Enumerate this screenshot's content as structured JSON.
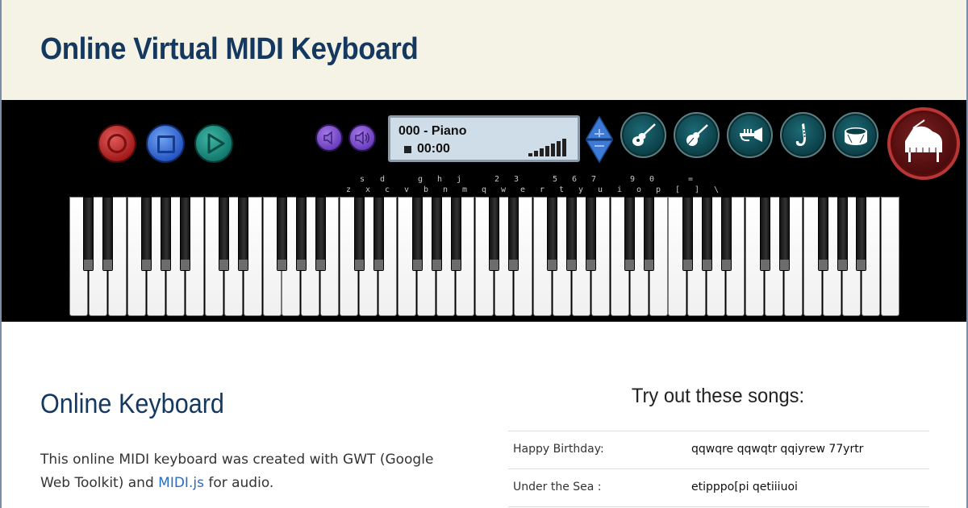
{
  "header": {
    "title": "Online Virtual MIDI Keyboard"
  },
  "controls": {
    "record_icon": "record-icon",
    "stop_icon": "stop-icon",
    "play_icon": "play-icon",
    "volume_down_icon": "volume-down-icon",
    "volume_up_icon": "volume-up-icon"
  },
  "display": {
    "instrument": "000 - Piano",
    "time": "00:00",
    "volume_level": 7,
    "volume_max": 7
  },
  "instruments": [
    "guitar-icon",
    "violin-icon",
    "trumpet-icon",
    "saxophone-icon",
    "drum-icon",
    "grand-piano-icon"
  ],
  "keymap": {
    "upper": [
      "s",
      "d",
      "g",
      "h",
      "j",
      "2",
      "3",
      "5",
      "6",
      "7",
      "9",
      "0",
      "="
    ],
    "lower": [
      "z",
      "x",
      "c",
      "v",
      "b",
      "n",
      "m",
      "q",
      "w",
      "e",
      "r",
      "t",
      "y",
      "u",
      "i",
      "o",
      "p",
      "[",
      "]",
      "\\"
    ]
  },
  "content": {
    "heading": "Online Keyboard",
    "para_before": "This online MIDI keyboard was created with GWT (Google Web Toolkit) and ",
    "para_link": "MIDI.js",
    "para_after": " for audio."
  },
  "songs": {
    "title": "Try out these songs:",
    "rows": [
      {
        "name": "Happy Birthday:",
        "notes": "qqwqre qqwqtr qqiyrew 77yrtr"
      },
      {
        "name": "Under the Sea :",
        "notes": "etipppo[pi qetiiiuoi"
      }
    ]
  },
  "colors": {
    "header_bg": "#f4f3e5",
    "title": "#14385f",
    "link": "#2a6cc0",
    "record": "#a51b1b",
    "stop": "#2858c6",
    "play": "#137a6e",
    "volume": "#6b3fbf",
    "display_bg": "#cfdde8",
    "instrument_btn": "#0b3e46",
    "piano_btn_ring": "#b83636"
  }
}
